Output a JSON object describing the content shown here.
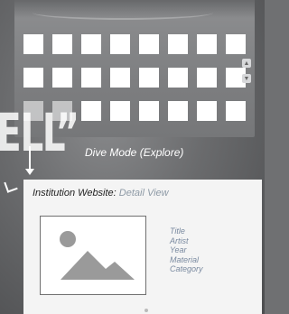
{
  "dive_mode": {
    "label": "Dive Mode (Explore)",
    "tile_rows": 3,
    "tile_cols": 8,
    "side_buttons": [
      "up-arrow",
      "down-arrow"
    ]
  },
  "decorative_text": "ELL”",
  "institution_card": {
    "title": "Institution Website:",
    "subtitle": "Detail View",
    "image_icon": "image-placeholder-icon",
    "fields": [
      "Title",
      "Artist",
      "Year",
      "Material",
      "Category"
    ]
  },
  "colors": {
    "field_text": "#7a8aa0",
    "subtitle_text": "#8e9aa6"
  }
}
